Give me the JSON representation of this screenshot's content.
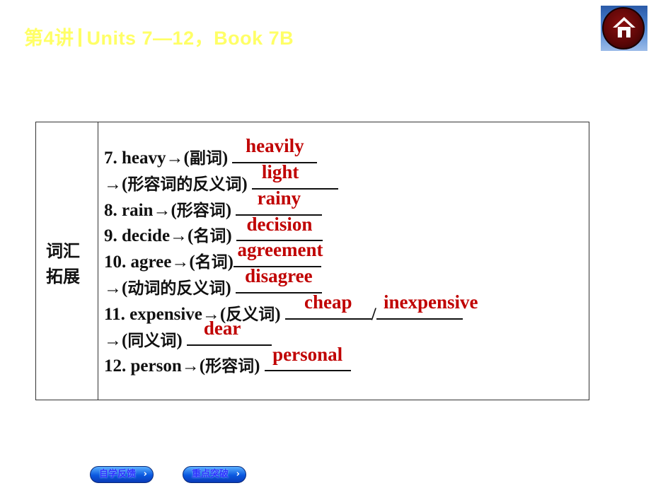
{
  "header": {
    "lesson": "第4讲",
    "title": "Units 7—12，Book 7B",
    "home_icon": "home-icon"
  },
  "section": {
    "label_line1": "词汇",
    "label_line2": "拓展"
  },
  "items": [
    {
      "prefix": "7.  heavy→(",
      "cn": "副词",
      "suffix": ") ",
      "answer": "heavily"
    },
    {
      "prefix": "→(",
      "cn": "形容词的反义词",
      "suffix": ") ",
      "answer": "light"
    },
    {
      "prefix": "8.   rain→(",
      "cn": "形容词",
      "suffix": ") ",
      "answer": "rainy"
    },
    {
      "prefix": "9.   decide→(",
      "cn": "名词",
      "suffix": ")  ",
      "answer": "decision"
    },
    {
      "prefix": "10.   agree→(",
      "cn": "名词",
      "suffix": ")",
      "answer": "agreement"
    },
    {
      "prefix": "→(",
      "cn": "动词的反义词",
      "suffix": ")  ",
      "answer": "disagree"
    },
    {
      "prefix": "11.   expensive→(",
      "cn": "反义词",
      "suffix": ") ",
      "answer": "cheap",
      "separator": "/",
      "answer2": "inexpensive"
    },
    {
      "prefix": "→(",
      "cn": "同义词",
      "suffix": ")  ",
      "answer": "dear"
    },
    {
      "prefix": "12.   person→(",
      "cn": "形容词",
      "suffix": ") ",
      "answer": "personal"
    }
  ],
  "footer": {
    "btn1_label": "自学反馈",
    "btn2_label": "重点突破",
    "chevron": "›"
  },
  "colors": {
    "title": "#ffff66",
    "answer": "#c00000",
    "home_button": "#6a0a0a",
    "nav_button": "#0a58e0"
  }
}
